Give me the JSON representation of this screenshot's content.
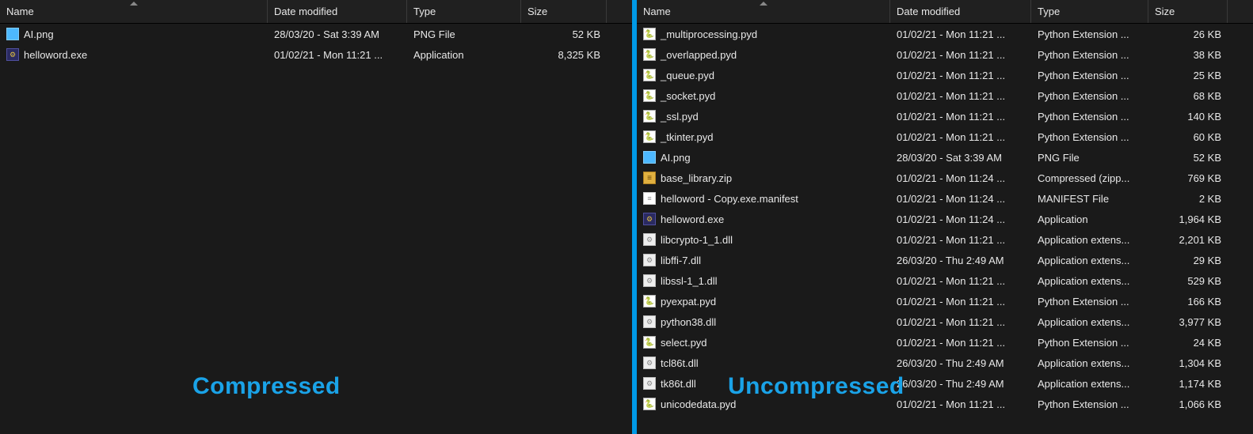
{
  "columns": {
    "name": "Name",
    "date": "Date modified",
    "type": "Type",
    "size": "Size"
  },
  "labels": {
    "left": "Compressed",
    "right": "Uncompressed"
  },
  "icons": {
    "png": "image-icon",
    "exe": "application-icon",
    "pyd": "python-ext-icon",
    "zip": "zip-icon",
    "manifest": "text-file-icon",
    "dll": "dll-icon"
  },
  "left_files": [
    {
      "icon": "img",
      "name": "AI.png",
      "date": "28/03/20 - Sat 3:39 AM",
      "type": "PNG File",
      "size": "52 KB"
    },
    {
      "icon": "exe",
      "name": "helloword.exe",
      "date": "01/02/21 - Mon 11:21 ...",
      "type": "Application",
      "size": "8,325 KB"
    }
  ],
  "right_files": [
    {
      "icon": "pyd",
      "name": "_multiprocessing.pyd",
      "date": "01/02/21 - Mon 11:21 ...",
      "type": "Python Extension ...",
      "size": "26 KB"
    },
    {
      "icon": "pyd",
      "name": "_overlapped.pyd",
      "date": "01/02/21 - Mon 11:21 ...",
      "type": "Python Extension ...",
      "size": "38 KB"
    },
    {
      "icon": "pyd",
      "name": "_queue.pyd",
      "date": "01/02/21 - Mon 11:21 ...",
      "type": "Python Extension ...",
      "size": "25 KB"
    },
    {
      "icon": "pyd",
      "name": "_socket.pyd",
      "date": "01/02/21 - Mon 11:21 ...",
      "type": "Python Extension ...",
      "size": "68 KB"
    },
    {
      "icon": "pyd",
      "name": "_ssl.pyd",
      "date": "01/02/21 - Mon 11:21 ...",
      "type": "Python Extension ...",
      "size": "140 KB"
    },
    {
      "icon": "pyd",
      "name": "_tkinter.pyd",
      "date": "01/02/21 - Mon 11:21 ...",
      "type": "Python Extension ...",
      "size": "60 KB"
    },
    {
      "icon": "img",
      "name": "AI.png",
      "date": "28/03/20 - Sat 3:39 AM",
      "type": "PNG File",
      "size": "52 KB"
    },
    {
      "icon": "zip",
      "name": "base_library.zip",
      "date": "01/02/21 - Mon 11:24 ...",
      "type": "Compressed (zipp...",
      "size": "769 KB"
    },
    {
      "icon": "txt",
      "name": "helloword - Copy.exe.manifest",
      "date": "01/02/21 - Mon 11:24 ...",
      "type": "MANIFEST File",
      "size": "2 KB"
    },
    {
      "icon": "exe",
      "name": "helloword.exe",
      "date": "01/02/21 - Mon 11:24 ...",
      "type": "Application",
      "size": "1,964 KB"
    },
    {
      "icon": "dll",
      "name": "libcrypto-1_1.dll",
      "date": "01/02/21 - Mon 11:21 ...",
      "type": "Application extens...",
      "size": "2,201 KB"
    },
    {
      "icon": "dll",
      "name": "libffi-7.dll",
      "date": "26/03/20 - Thu 2:49 AM",
      "type": "Application extens...",
      "size": "29 KB"
    },
    {
      "icon": "dll",
      "name": "libssl-1_1.dll",
      "date": "01/02/21 - Mon 11:21 ...",
      "type": "Application extens...",
      "size": "529 KB"
    },
    {
      "icon": "pyd",
      "name": "pyexpat.pyd",
      "date": "01/02/21 - Mon 11:21 ...",
      "type": "Python Extension ...",
      "size": "166 KB"
    },
    {
      "icon": "dll",
      "name": "python38.dll",
      "date": "01/02/21 - Mon 11:21 ...",
      "type": "Application extens...",
      "size": "3,977 KB"
    },
    {
      "icon": "pyd",
      "name": "select.pyd",
      "date": "01/02/21 - Mon 11:21 ...",
      "type": "Python Extension ...",
      "size": "24 KB"
    },
    {
      "icon": "dll",
      "name": "tcl86t.dll",
      "date": "26/03/20 - Thu 2:49 AM",
      "type": "Application extens...",
      "size": "1,304 KB"
    },
    {
      "icon": "dll",
      "name": "tk86t.dll",
      "date": "26/03/20 - Thu 2:49 AM",
      "type": "Application extens...",
      "size": "1,174 KB"
    },
    {
      "icon": "pyd",
      "name": "unicodedata.pyd",
      "date": "01/02/21 - Mon 11:21 ...",
      "type": "Python Extension ...",
      "size": "1,066 KB"
    }
  ]
}
